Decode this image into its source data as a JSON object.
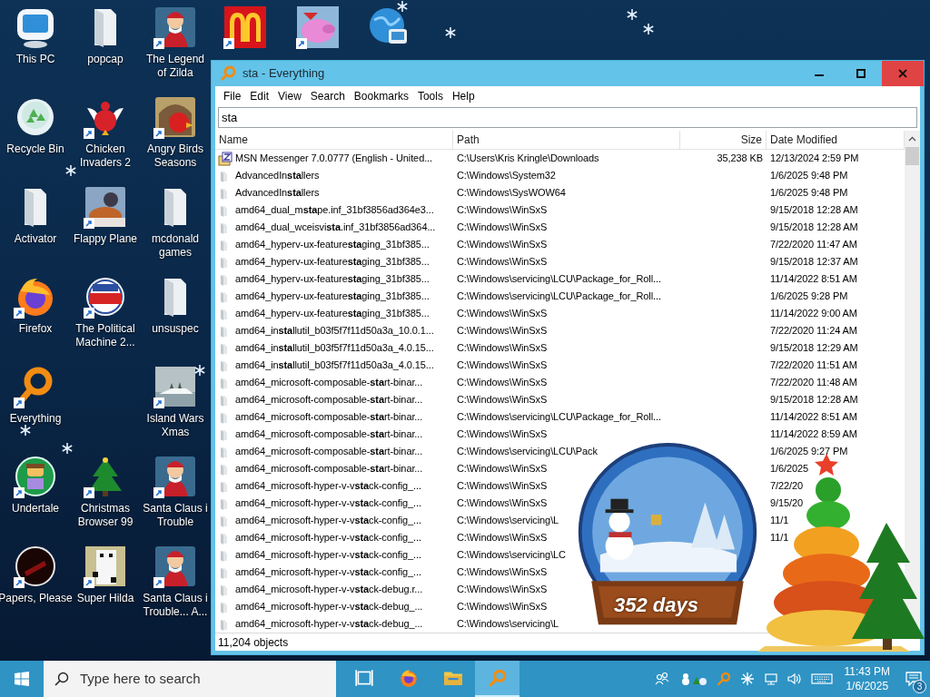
{
  "desktop": {
    "icons": [
      {
        "label_lines": [
          "This PC"
        ],
        "shortcut": false
      },
      {
        "label_lines": [
          "popcap"
        ],
        "shortcut": false
      },
      {
        "label_lines": [
          "The Legend",
          "of Zilda"
        ],
        "shortcut": true
      },
      {
        "shortcut": true
      },
      {
        "shortcut": true
      },
      {
        "shortcut": false
      },
      {
        "label_lines": [
          "Recycle Bin"
        ],
        "shortcut": false
      },
      {
        "label_lines": [
          "Chicken",
          "Invaders 2"
        ],
        "shortcut": true
      },
      {
        "label_lines": [
          "Angry Birds",
          "Seasons"
        ],
        "shortcut": true
      },
      {
        "label_lines": [
          "Activator"
        ],
        "shortcut": false
      },
      {
        "label_lines": [
          "Flappy Plane"
        ],
        "shortcut": true
      },
      {
        "label_lines": [
          "mcdonald",
          "games"
        ],
        "shortcut": false
      },
      {
        "label_lines": [
          "Firefox"
        ],
        "shortcut": true
      },
      {
        "label_lines": [
          "The Political",
          "Machine 2..."
        ],
        "shortcut": true
      },
      {
        "label_lines": [
          "unsuspec"
        ],
        "shortcut": false
      },
      {
        "label_lines": [
          "Everything"
        ],
        "shortcut": true
      },
      {
        "label_lines": [
          "Island Wars",
          "Xmas"
        ],
        "shortcut": true
      },
      {
        "label_lines": [
          "Undertale"
        ],
        "shortcut": true
      },
      {
        "label_lines": [
          "Christmas",
          "Browser 99"
        ],
        "shortcut": true
      },
      {
        "label_lines": [
          "Santa Claus i",
          "Trouble"
        ],
        "shortcut": true
      },
      {
        "label_lines": [
          "Papers, Please"
        ],
        "shortcut": true
      },
      {
        "label_lines": [
          "Super Hilda"
        ],
        "shortcut": true
      },
      {
        "label_lines": [
          "Santa Claus i",
          "Trouble... A..."
        ],
        "shortcut": true
      }
    ]
  },
  "window": {
    "title": "sta - Everything",
    "menu": [
      "File",
      "Edit",
      "View",
      "Search",
      "Bookmarks",
      "Tools",
      "Help"
    ],
    "search": {
      "value": "sta"
    },
    "table": {
      "columns": [
        "Name",
        "Path",
        "Size",
        "Date Modified"
      ],
      "rows": [
        {
          "kind": "file",
          "name": "MSN Messenger 7.0.0777 (English - United...",
          "path": "C:\\Users\\Kris Kringle\\Downloads",
          "size": "35,238 KB",
          "date": "12/13/2024 2:59 PM"
        },
        {
          "kind": "folder",
          "name": "AdvancedIn**sta**llers",
          "path": "C:\\Windows\\System32",
          "date": "1/6/2025 9:48 PM"
        },
        {
          "kind": "folder",
          "name": "AdvancedIn**sta**llers",
          "path": "C:\\Windows\\SysWOW64",
          "date": "1/6/2025 9:48 PM"
        },
        {
          "kind": "folder",
          "name": "amd64_dual_m**sta**pe.inf_31bf3856ad364e3...",
          "path": "C:\\Windows\\WinSxS",
          "date": "9/15/2018 12:28 AM"
        },
        {
          "kind": "folder",
          "name": "amd64_dual_wceisvi**sta**.inf_31bf3856ad364...",
          "path": "C:\\Windows\\WinSxS",
          "date": "9/15/2018 12:28 AM"
        },
        {
          "kind": "folder",
          "name": "amd64_hyperv-ux-feature**sta**ging_31bf385...",
          "path": "C:\\Windows\\WinSxS",
          "date": "7/22/2020 11:47 AM"
        },
        {
          "kind": "folder",
          "name": "amd64_hyperv-ux-feature**sta**ging_31bf385...",
          "path": "C:\\Windows\\WinSxS",
          "date": "9/15/2018 12:37 AM"
        },
        {
          "kind": "folder",
          "name": "amd64_hyperv-ux-feature**sta**ging_31bf385...",
          "path": "C:\\Windows\\servicing\\LCU\\Package_for_Roll...",
          "date": "11/14/2022 8:51 AM"
        },
        {
          "kind": "folder",
          "name": "amd64_hyperv-ux-feature**sta**ging_31bf385...",
          "path": "C:\\Windows\\servicing\\LCU\\Package_for_Roll...",
          "date": "1/6/2025 9:28 PM"
        },
        {
          "kind": "folder",
          "name": "amd64_hyperv-ux-feature**sta**ging_31bf385...",
          "path": "C:\\Windows\\WinSxS",
          "date": "11/14/2022 9:00 AM"
        },
        {
          "kind": "folder",
          "name": "amd64_in**sta**llutil_b03f5f7f11d50a3a_10.0.1...",
          "path": "C:\\Windows\\WinSxS",
          "date": "7/22/2020 11:24 AM"
        },
        {
          "kind": "folder",
          "name": "amd64_in**sta**llutil_b03f5f7f11d50a3a_4.0.15...",
          "path": "C:\\Windows\\WinSxS",
          "date": "9/15/2018 12:29 AM"
        },
        {
          "kind": "folder",
          "name": "amd64_in**sta**llutil_b03f5f7f11d50a3a_4.0.15...",
          "path": "C:\\Windows\\WinSxS",
          "date": "7/22/2020 11:51 AM"
        },
        {
          "kind": "folder",
          "name": "amd64_microsoft-composable-**sta**rt-binar...",
          "path": "C:\\Windows\\WinSxS",
          "date": "7/22/2020 11:48 AM"
        },
        {
          "kind": "folder",
          "name": "amd64_microsoft-composable-**sta**rt-binar...",
          "path": "C:\\Windows\\WinSxS",
          "date": "9/15/2018 12:28 AM"
        },
        {
          "kind": "folder",
          "name": "amd64_microsoft-composable-**sta**rt-binar...",
          "path": "C:\\Windows\\servicing\\LCU\\Package_for_Roll...",
          "date": "11/14/2022 8:51 AM"
        },
        {
          "kind": "folder",
          "name": "amd64_microsoft-composable-**sta**rt-binar...",
          "path": "C:\\Windows\\WinSxS",
          "date": "11/14/2022 8:59 AM"
        },
        {
          "kind": "folder",
          "name": "amd64_microsoft-composable-**sta**rt-binar...",
          "path": "C:\\Windows\\servicing\\LCU\\Pack",
          "date": "1/6/2025 9:27 PM"
        },
        {
          "kind": "folder",
          "name": "amd64_microsoft-composable-**sta**rt-binar...",
          "path": "C:\\Windows\\WinSxS",
          "date": "1/6/2025"
        },
        {
          "kind": "folder",
          "name": "amd64_microsoft-hyper-v-v**sta**ck-config_...",
          "path": "C:\\Windows\\WinSxS",
          "date": "7/22/20"
        },
        {
          "kind": "folder",
          "name": "amd64_microsoft-hyper-v-v**sta**ck-config_...",
          "path": "C:\\Windows\\WinSxS",
          "date": "9/15/20"
        },
        {
          "kind": "folder",
          "name": "amd64_microsoft-hyper-v-v**sta**ck-config_...",
          "path": "C:\\Windows\\servicing\\L",
          "date": "11/1"
        },
        {
          "kind": "folder",
          "name": "amd64_microsoft-hyper-v-v**sta**ck-config_...",
          "path": "C:\\Windows\\WinSxS",
          "date": "11/1"
        },
        {
          "kind": "folder",
          "name": "amd64_microsoft-hyper-v-v**sta**ck-config_...",
          "path": "C:\\Windows\\servicing\\LC"
        },
        {
          "kind": "folder",
          "name": "amd64_microsoft-hyper-v-v**sta**ck-config_...",
          "path": "C:\\Windows\\WinSxS"
        },
        {
          "kind": "folder",
          "name": "amd64_microsoft-hyper-v-v**sta**ck-debug.r...",
          "path": "C:\\Windows\\WinSxS"
        },
        {
          "kind": "folder",
          "name": "amd64_microsoft-hyper-v-v**sta**ck-debug_...",
          "path": "C:\\Windows\\WinSxS"
        },
        {
          "kind": "folder",
          "name": "amd64_microsoft-hyper-v-v**sta**ck-debug_...",
          "path": "C:\\Windows\\servicing\\L"
        }
      ]
    },
    "status_bar": "11,204 objects"
  },
  "widget": {
    "countdown": "352 days"
  },
  "taskbar": {
    "search_placeholder": "Type here to search",
    "apps": [
      {
        "selected": false
      },
      {
        "selected": false
      },
      {
        "selected": false
      },
      {
        "selected": true
      }
    ],
    "clock": {
      "time": "11:43 PM",
      "date": "1/6/2025"
    },
    "notifications": "3"
  }
}
